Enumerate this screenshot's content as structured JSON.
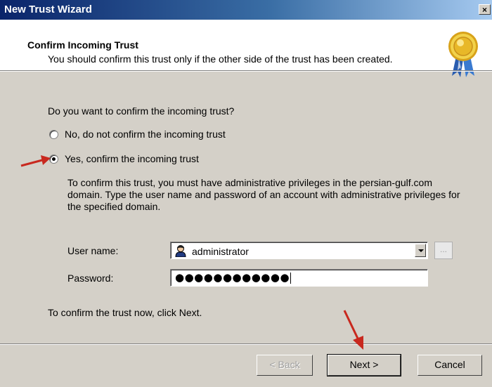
{
  "window": {
    "title": "New Trust Wizard",
    "close_label": "×"
  },
  "header": {
    "title": "Confirm Incoming Trust",
    "subtitle": "You should confirm this trust only if the other side of the trust has been created."
  },
  "body": {
    "question": "Do you want to confirm the incoming trust?",
    "options": [
      {
        "label": "No, do not confirm the incoming trust",
        "selected": false
      },
      {
        "label": "Yes, confirm the incoming trust",
        "selected": true
      }
    ],
    "description": "To confirm this trust, you must have administrative privileges in the persian-gulf.com domain. Type the user name and password of an account with administrative privileges for the specified domain.",
    "username_label": "User name:",
    "username_value": "administrator",
    "browse_label": "...",
    "password_label": "Password:",
    "password_value": "●●●●●●●●●●●●",
    "footer_note": "To confirm the trust now, click Next."
  },
  "buttons": {
    "back": "< Back",
    "next": "Next >",
    "cancel": "Cancel"
  },
  "colors": {
    "annotation_arrow": "#c8281e",
    "titlebar": "#0a246a",
    "dialog_bg": "#d4d0c8"
  }
}
